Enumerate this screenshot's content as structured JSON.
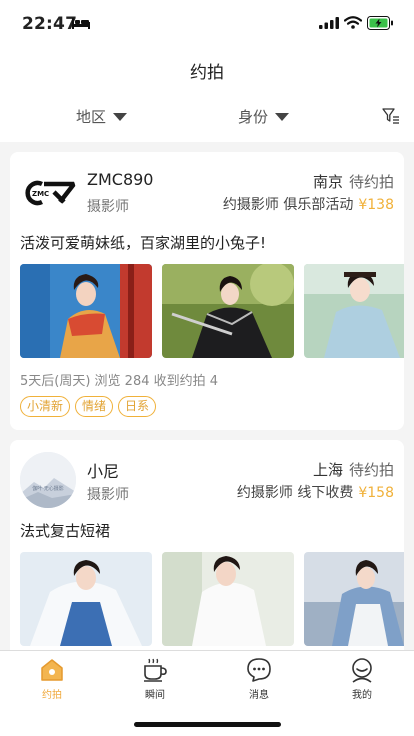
{
  "status_bar": {
    "time": "22:47"
  },
  "nav": {
    "title": "约拍"
  },
  "filters": {
    "area": "地区",
    "identity": "身份"
  },
  "posts": [
    {
      "username": "ZMC890",
      "avatar_text": "ZMC",
      "role": "摄影师",
      "city": "南京",
      "state": "待约拍",
      "seeking": "约摄影师",
      "fee_type": "俱乐部活动",
      "price": "¥138",
      "description": "活泼可爱萌妹纸，百家湖里的小兔子!",
      "meta": "5天后(周天) 浏览 284 收到约拍 4",
      "tags": [
        "小清新",
        "情绪",
        "日系"
      ]
    },
    {
      "username": "小尼",
      "avatar_text": "伽叶·无心摄影",
      "role": "摄影师",
      "city": "上海",
      "state": "待约拍",
      "seeking": "约摄影师",
      "fee_type": "线下收费",
      "price": "¥158",
      "description": "法式复古短裙"
    }
  ],
  "tabs": [
    {
      "label": "约拍",
      "icon": "home-icon",
      "active": true
    },
    {
      "label": "瞬间",
      "icon": "coffee-cup-icon"
    },
    {
      "label": "消息",
      "icon": "chat-bubble-icon"
    },
    {
      "label": "我的",
      "icon": "user-face-icon"
    }
  ],
  "colors": {
    "accent": "#f0b13a",
    "background": "#f4f4f4"
  }
}
